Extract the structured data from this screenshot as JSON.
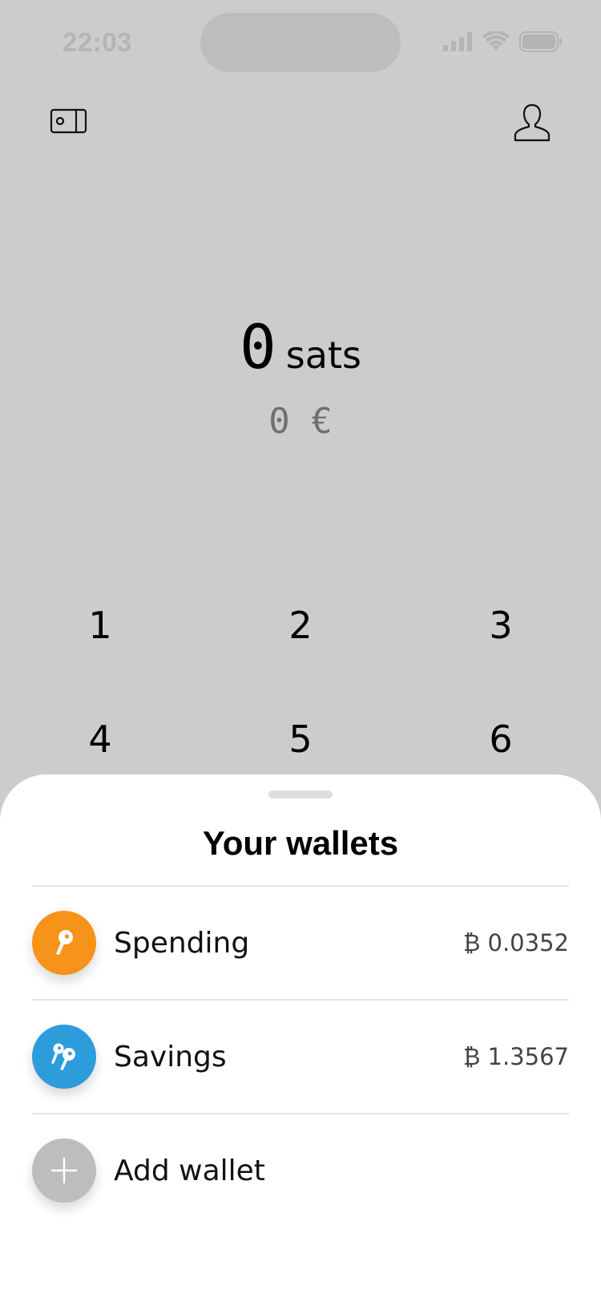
{
  "status_bar": {
    "time": "22:03",
    "icons": [
      "cellular-signal-icon",
      "wifi-icon",
      "battery-icon"
    ]
  },
  "header": {
    "left_icon": "wallet-icon",
    "right_icon": "profile-icon"
  },
  "amount": {
    "value": "0",
    "unit": "sats",
    "fiat": "0 €"
  },
  "keypad": {
    "rows": [
      [
        "1",
        "2",
        "3"
      ],
      [
        "4",
        "5",
        "6"
      ]
    ]
  },
  "sheet": {
    "title": "Your wallets",
    "wallets": [
      {
        "name": "Spending",
        "balance": "₿ 0.0352",
        "icon": "single-key-icon",
        "color": "#F7931A"
      },
      {
        "name": "Savings",
        "balance": "₿ 1.3567",
        "icon": "multi-key-icon",
        "color": "#2D9CDB"
      }
    ],
    "add_label": "Add wallet",
    "add_icon": "plus-icon",
    "add_color": "#BDBDBD"
  },
  "colors": {
    "backdrop": "#CCCCCC",
    "sheet": "#FFFFFF",
    "text": "#000000",
    "muted": "#6F6F6F"
  }
}
